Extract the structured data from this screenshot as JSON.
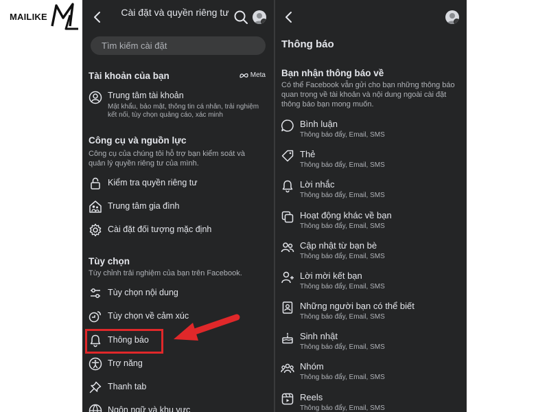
{
  "logo": {
    "text": "MAILIKE",
    "mark_text": "ML"
  },
  "left": {
    "title": "Cài đặt và quyền riêng tư",
    "search_placeholder": "Tìm kiếm cài đặt",
    "account": {
      "heading": "Tài khoản của bạn",
      "meta_label": "Meta",
      "items": [
        {
          "label": "Trung tâm tài khoản",
          "description": "Mật khẩu, bảo mật, thông tin cá nhân, trải nghiệm kết nối, tùy chọn quảng cáo, xác minh",
          "icon": "account-circle-icon"
        }
      ]
    },
    "tools": {
      "heading": "Công cụ và nguồn lực",
      "description": "Công cụ của chúng tôi hỗ trợ bạn kiểm soát và quản lý quyền riêng tư của mình.",
      "items": [
        {
          "label": "Kiểm tra quyền riêng tư",
          "icon": "lock-icon"
        },
        {
          "label": "Trung tâm gia đình",
          "icon": "family-house-icon"
        },
        {
          "label": "Cài đặt đối tượng mặc định",
          "icon": "gear-icon"
        }
      ]
    },
    "preferences": {
      "heading": "Tùy chọn",
      "description": "Tùy chỉnh trải nghiệm của bạn trên Facebook.",
      "items": [
        {
          "label": "Tùy chọn nội dung",
          "icon": "sliders-icon"
        },
        {
          "label": "Tùy chọn về cảm xúc",
          "icon": "reactions-icon"
        },
        {
          "label": "Thông báo",
          "icon": "bell-icon"
        },
        {
          "label": "Trợ năng",
          "icon": "accessibility-icon"
        },
        {
          "label": "Thanh tab",
          "icon": "pin-icon"
        },
        {
          "label": "Ngôn ngữ và khu vực",
          "icon": "globe-icon"
        }
      ]
    }
  },
  "right": {
    "title": "Thông báo",
    "heading": "Bạn nhận thông báo về",
    "description": "Có thể Facebook vẫn gửi cho bạn những thông báo quan trọng về tài khoản và nội dung ngoài cài đặt thông báo bạn mong muốn.",
    "items": [
      {
        "label": "Bình luận",
        "sub": "Thông báo đẩy, Email, SMS",
        "icon": "comment-icon"
      },
      {
        "label": "Thẻ",
        "sub": "Thông báo đẩy, Email, SMS",
        "icon": "tag-icon"
      },
      {
        "label": "Lời nhắc",
        "sub": "Thông báo đẩy, Email, SMS",
        "icon": "bell-icon"
      },
      {
        "label": "Hoạt động khác về bạn",
        "sub": "Thông báo đẩy, Email, SMS",
        "icon": "copy-squares-icon"
      },
      {
        "label": "Cập nhật từ bạn bè",
        "sub": "Thông báo đẩy, Email, SMS",
        "icon": "friends-icon"
      },
      {
        "label": "Lời mời kết bạn",
        "sub": "Thông báo đẩy, Email, SMS",
        "icon": "add-friend-icon"
      },
      {
        "label": "Những người bạn có thể biết",
        "sub": "Thông báo đẩy, Email, SMS",
        "icon": "contact-book-icon"
      },
      {
        "label": "Sinh nhật",
        "sub": "Thông báo đẩy, Email, SMS",
        "icon": "birthday-cake-icon"
      },
      {
        "label": "Nhóm",
        "sub": "Thông báo đẩy, Email, SMS",
        "icon": "group-icon"
      },
      {
        "label": "Reels",
        "sub": "Thông báo đẩy, Email, SMS",
        "icon": "reels-icon"
      }
    ]
  },
  "colors": {
    "panel_bg": "#242526",
    "search_bg": "#3a3b3c",
    "text_primary": "#e4e6eb",
    "text_secondary": "#b0b3b8",
    "annotation_red": "#e0282a"
  }
}
